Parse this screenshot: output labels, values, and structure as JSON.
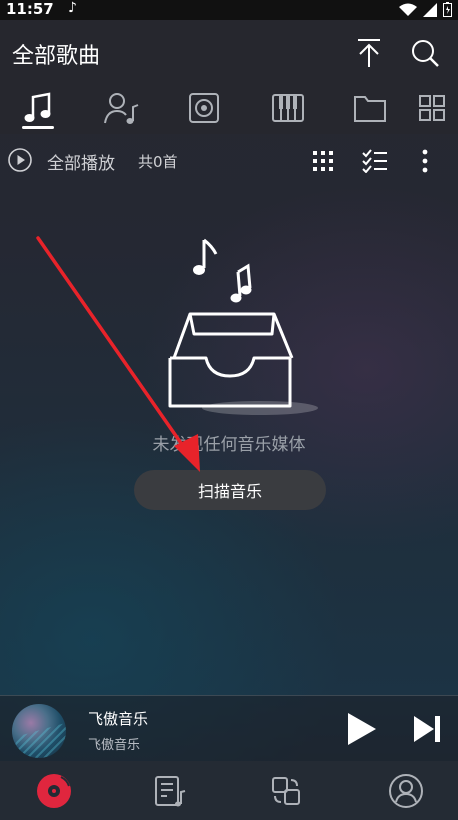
{
  "status_bar": {
    "time": "11:57"
  },
  "header": {
    "title": "全部歌曲"
  },
  "toolbar": {
    "play_all_label": "全部播放",
    "count": "共0首"
  },
  "empty_state": {
    "message": "未发现任何音乐媒体",
    "scan_button": "扫描音乐"
  },
  "player": {
    "title": "飞傲音乐",
    "artist": "飞傲音乐"
  },
  "tabs": [
    "songs-tab",
    "artists-tab",
    "albums-tab",
    "genres-tab",
    "folders-tab",
    "more-tab"
  ],
  "colors": {
    "accent": "#e0263e",
    "annotation_arrow": "#e8232a",
    "button_bg": "#3a3c40"
  }
}
